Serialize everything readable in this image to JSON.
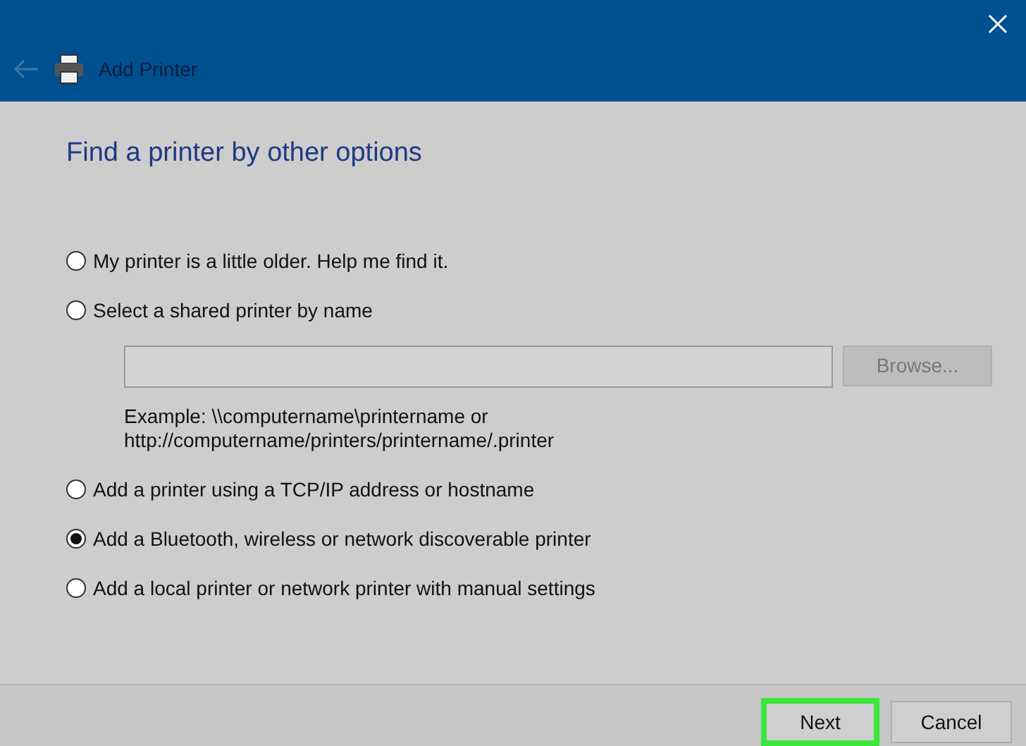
{
  "window": {
    "title": "Add Printer",
    "back_disabled": true
  },
  "heading": "Find a printer by other options",
  "options": [
    {
      "label": "My printer is a little older. Help me find it.",
      "selected": false
    },
    {
      "label": "Select a shared printer by name",
      "selected": false,
      "kind": "name"
    },
    {
      "label": "Add a printer using a TCP/IP address or hostname",
      "selected": false
    },
    {
      "label": "Add a Bluetooth, wireless or network discoverable printer",
      "selected": true
    },
    {
      "label": "Add a local printer or network printer with manual settings",
      "selected": false
    }
  ],
  "name_field": {
    "browse": {
      "label": "Browse...",
      "disabled": true
    },
    "example_lines": [
      "Example: \\\\computername\\printername or",
      "http://computername/printers/printername/.printer"
    ]
  },
  "buttons": [
    {
      "label": "Next",
      "highlighted": true
    },
    {
      "label": "Cancel",
      "highlighted": false
    }
  ]
}
